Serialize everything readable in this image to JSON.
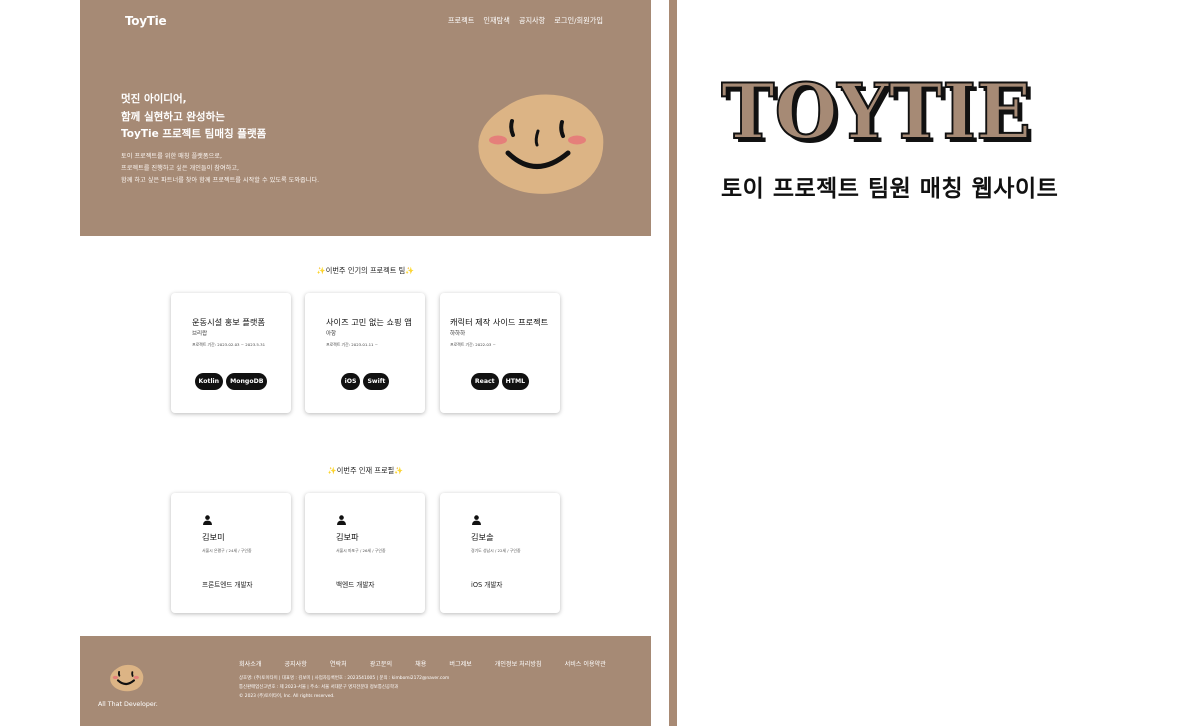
{
  "brand_color": "#a68a75",
  "site": {
    "logo": "ToyTie",
    "nav": [
      "프로젝트",
      "인재탐색",
      "공지사항",
      "로그인/회원가입"
    ],
    "hero": {
      "title_lines": [
        "멋진 아이디어,",
        "함께 실현하고 완성하는",
        "ToyTie 프로젝트 팀매칭 플랫폼"
      ],
      "desc_lines": [
        "토이 프로젝트를 위한 매칭 플랫폼으로,",
        "프로젝트를 진행하고 싶은 개인들이 참여하고,",
        "함께 하고 싶은 파트너를 찾아 함께 프로젝트를 시작할 수 있도록 도와줍니다."
      ],
      "illustration": "smiley-face-illustration"
    },
    "projects_section": {
      "title": "이번주 인기의 프로젝트 팀",
      "sparkle": "✨",
      "cards": [
        {
          "title": "운동시설 홍보 플랫폼",
          "subtitle": "브리랍",
          "period": "프로젝트 기간: 2023.02.03 ~ 2023.5.31",
          "tags": [
            "Kotlin",
            "MongoDB"
          ]
        },
        {
          "title": "사이즈 고민 없는 쇼핑 앱",
          "subtitle": "아항",
          "period": "프로젝트 기간: 2023.01.11 ~",
          "tags": [
            "iOS",
            "Swift"
          ]
        },
        {
          "title": "캐릭터 제작 사이드 프로젝트",
          "subtitle": "하하하",
          "period": "프로젝트 기간: 2022.03 ~",
          "tags": [
            "React",
            "HTML"
          ]
        }
      ]
    },
    "profiles_section": {
      "title": "이번주 인재 프로필",
      "sparkle": "✨",
      "cards": [
        {
          "name": "김보미",
          "meta": "서울시 은평구 / 24세 / 구인중",
          "role": "프론트엔드 개발자"
        },
        {
          "name": "김보파",
          "meta": "서울시 마포구 / 26세 / 구인중",
          "role": "백엔드 개발자"
        },
        {
          "name": "김보솔",
          "meta": "경기도 성남시 / 22세 / 구인중",
          "role": "iOS 개발자"
        }
      ]
    },
    "footer": {
      "tagline": "All That Developer.",
      "links": [
        "회사소개",
        "공지사항",
        "연락처",
        "광고문의",
        "채용",
        "버그제보",
        "개인정보 처리방침",
        "서비스 이용약관"
      ],
      "info_lines": [
        "상호명: (주)토이타이 | 대표명 : 김보미 | 사업자등록번호 : 2023541005 | 문의 : kimbomi2172@naver.com",
        "통신판매업신고번호 : 제 2023-서울 | 주소: 서울 서대문구 명지전문대 정보통신공학과",
        "© 2023 (주)토이타이, Inc. All rights reserved."
      ]
    }
  },
  "promo": {
    "title": "TOYTIE",
    "subtitle": "토이 프로젝트 팀원 매칭 웹사이트"
  }
}
